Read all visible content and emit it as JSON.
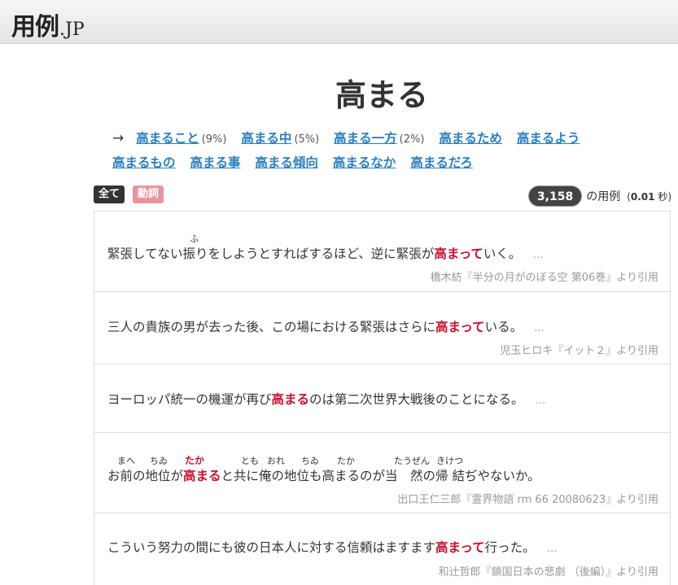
{
  "site": {
    "logo_main": "用例",
    "logo_suffix": ".JP"
  },
  "page": {
    "title": "高まる"
  },
  "related": {
    "arrow": "→",
    "items": [
      {
        "label": "高まること",
        "pct": "(9%)"
      },
      {
        "label": "高まる中",
        "pct": "(5%)"
      },
      {
        "label": "高まる一方",
        "pct": "(2%)"
      },
      {
        "label": "高まるため",
        "pct": ""
      },
      {
        "label": "高まるよう",
        "pct": ""
      },
      {
        "label": "高まるもの",
        "pct": ""
      },
      {
        "label": "高まる事",
        "pct": ""
      },
      {
        "label": "高まる傾向",
        "pct": ""
      },
      {
        "label": "高まるなか",
        "pct": ""
      },
      {
        "label": "高まるだろ",
        "pct": ""
      }
    ]
  },
  "filters": {
    "all": "全て",
    "verb": "動詞"
  },
  "stats": {
    "count": "3,158",
    "count_label": "の用例",
    "time_prefix": "(",
    "time_value": "0.01",
    "time_suffix": " 秒)"
  },
  "results": [
    {
      "pre": "緊張してない振りをしようとすればするほど、逆に緊張が",
      "hl": "高まって",
      "post": "いく。",
      "more": "…",
      "source": "橋木紡『半分の月がのぼる空 第06巻』より引用",
      "ruby": [
        {
          "text": "ふ"
        }
      ]
    },
    {
      "pre": "三人の貴族の男が去った後、この場における緊張はさらに",
      "hl": "高まって",
      "post": "いる。",
      "more": "…",
      "source": "児玉ヒロキ『イット２』より引用",
      "ruby": []
    },
    {
      "pre": "ヨーロッパ統一の機運が再び",
      "hl": "高まる",
      "post": "のは第二次世界大戦後のことになる。",
      "more": "…",
      "source": "",
      "ruby": []
    },
    {
      "pre": "お前の地位が",
      "hl": "高まる",
      "post": "と共に俺の地位も高まるのが当　然の帰 結ぢやないか。",
      "more": "",
      "source": "出口王仁三郎『霊界物語 rm 66 20080623』より引用",
      "ruby": [
        {
          "text": "まへ"
        },
        {
          "text": "ちゐ"
        },
        {
          "text": "たか"
        },
        {
          "text": "とも"
        },
        {
          "text": "おれ"
        },
        {
          "text": "ちゐ"
        },
        {
          "text": "たか"
        },
        {
          "text": "たうぜん"
        },
        {
          "text": "きけつ"
        }
      ]
    },
    {
      "pre": "こういう努力の間にも彼の日本人に対する信頼はますます",
      "hl": "高まって",
      "post": "行った。",
      "more": "…",
      "source": "和辻哲郎『鎖国日本の悲劇 （後編）』より引用",
      "ruby": []
    }
  ]
}
